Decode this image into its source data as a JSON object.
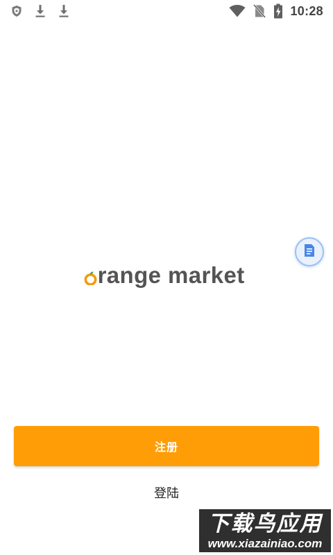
{
  "status_bar": {
    "time": "10:28",
    "left_icons": [
      "shield-icon",
      "download-icon",
      "download-icon"
    ],
    "right_icons": [
      "wifi-icon",
      "no-sim-icon",
      "battery-charging-icon"
    ]
  },
  "app": {
    "brand": "orange market",
    "brand_icon": "orange-fruit-icon",
    "accent_color": "#ff9d06"
  },
  "floating_button": {
    "icon": "document-icon"
  },
  "actions": {
    "register_label": "注册",
    "login_label": "登陆"
  },
  "watermark": {
    "title": "下载鸟应用",
    "url": "www.xiazainiao.com"
  }
}
